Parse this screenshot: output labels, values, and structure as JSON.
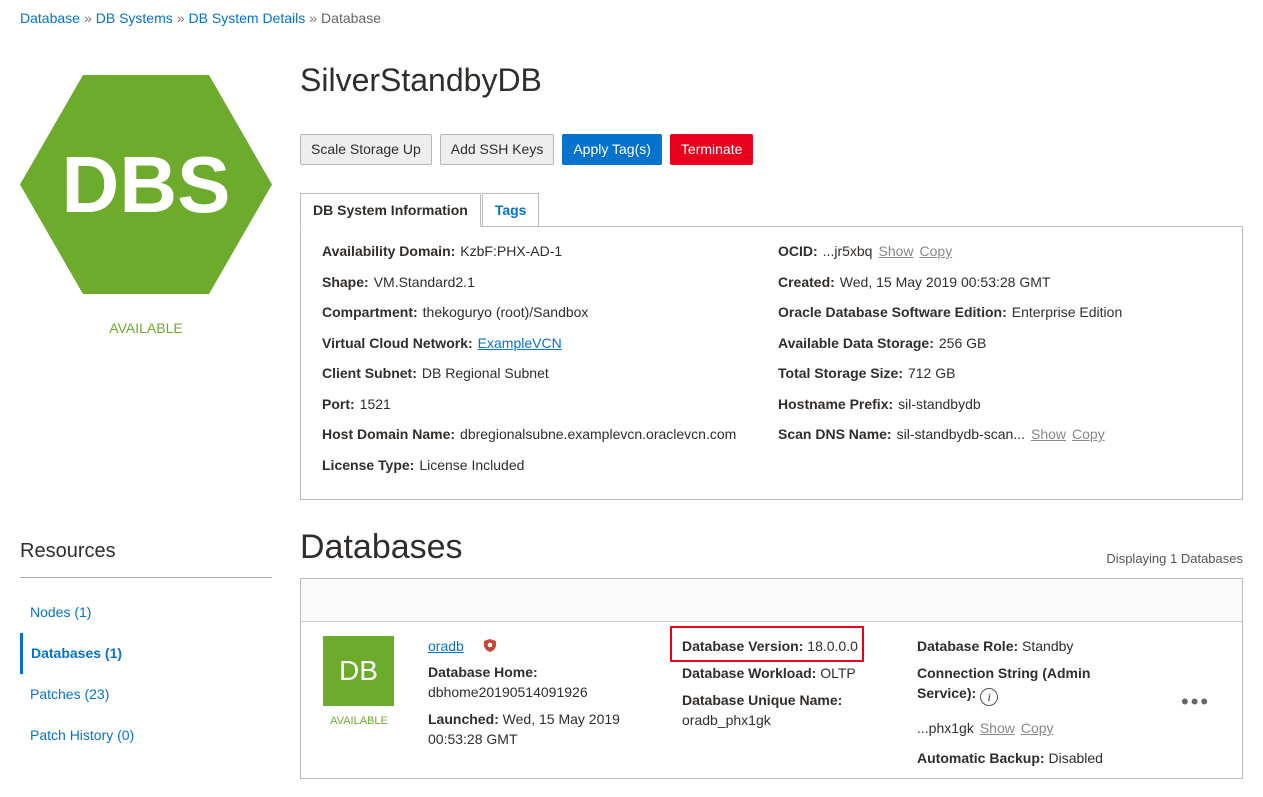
{
  "breadcrumb": [
    {
      "label": "Database",
      "link": true
    },
    {
      "label": "DB Systems",
      "link": true
    },
    {
      "label": "DB System Details",
      "link": true
    },
    {
      "label": "Database",
      "link": false
    }
  ],
  "hex": {
    "label": "DBS",
    "color": "#6cab2c",
    "status": "AVAILABLE"
  },
  "title": "SilverStandbyDB",
  "actions": {
    "scale": "Scale Storage Up",
    "ssh": "Add SSH Keys",
    "tags": "Apply Tag(s)",
    "terminate": "Terminate"
  },
  "tabs": {
    "info": "DB System Information",
    "tags": "Tags"
  },
  "info_left": [
    {
      "k": "Availability Domain:",
      "v": "KzbF:PHX-AD-1"
    },
    {
      "k": "Shape:",
      "v": "VM.Standard2.1"
    },
    {
      "k": "Compartment:",
      "v": "thekoguryo (root)/Sandbox"
    },
    {
      "k": "Virtual Cloud Network:",
      "v": "ExampleVCN"
    },
    {
      "k": "Client Subnet:",
      "v": "DB Regional Subnet"
    },
    {
      "k": "Port:",
      "v": "1521"
    },
    {
      "k": "Host Domain Name:",
      "v": "dbregionalsubne.examplevcn.oraclevcn.com"
    },
    {
      "k": "License Type:",
      "v": "License Included"
    }
  ],
  "info_right": [
    {
      "k": "OCID:",
      "v": "...jr5xbq",
      "show": "Show",
      "copy": "Copy"
    },
    {
      "k": "Created:",
      "v": "Wed, 15 May 2019 00:53:28 GMT"
    },
    {
      "k": "Oracle Database Software Edition:",
      "v": "Enterprise Edition"
    },
    {
      "k": "Available Data Storage:",
      "v": "256 GB"
    },
    {
      "k": "Total Storage Size:",
      "v": "712 GB"
    },
    {
      "k": "Hostname Prefix:",
      "v": "sil-standbydb"
    },
    {
      "k": "Scan DNS Name:",
      "v": "sil-standbydb-scan...",
      "show": "Show",
      "copy": "Copy"
    }
  ],
  "resources": {
    "title": "Resources",
    "items": [
      "Nodes (1)",
      "Databases (1)",
      "Patches (23)",
      "Patch History (0)"
    ]
  },
  "databases": {
    "heading": "Databases",
    "displaying": "Displaying 1 Databases",
    "tile": "DB",
    "status": "AVAILABLE",
    "name": "oradb",
    "home_label": "Database Home:",
    "home_value": "dbhome20190514091926",
    "launched_label": "Launched:",
    "launched_value_1": "Wed, 15 May 2019",
    "launched_value_2": "00:53:28 GMT",
    "version_label": "Database Version:",
    "version_value": "18.0.0.0",
    "workload_label": "Database Workload:",
    "workload_value": "OLTP",
    "unique_label": "Database Unique Name:",
    "unique_value": "oradb_phx1gk",
    "role_label": "Database Role:",
    "role_value": "Standby",
    "conn_label_1": "Connection String (Admin",
    "conn_label_2": "Service):",
    "conn_value": "...phx1gk",
    "show": "Show",
    "copy": "Copy",
    "backup_label": "Automatic Backup:",
    "backup_value": "Disabled",
    "info_icon": "i",
    "more": "•••"
  }
}
